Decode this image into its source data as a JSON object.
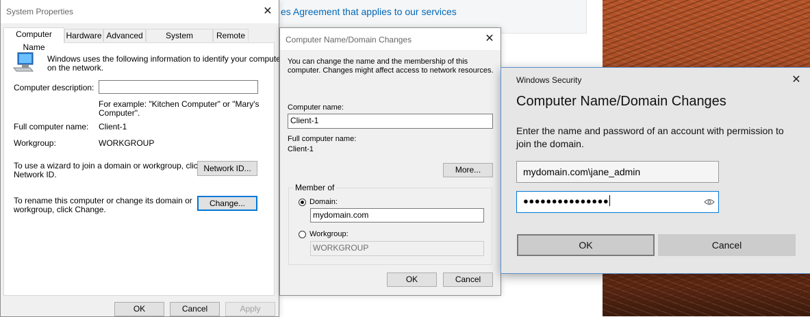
{
  "background": {
    "link_text": "es Agreement that applies to our services",
    "wallpaper": "desert-dunes"
  },
  "system_properties": {
    "title": "System Properties",
    "tabs": [
      "Computer Name",
      "Hardware",
      "Advanced",
      "System Protection",
      "Remote"
    ],
    "active_tab": "Computer Name",
    "intro_text_line1": "Windows uses the following information to identify your computer",
    "intro_text_line2": "on the network.",
    "description_label": "Computer description:",
    "description_value": "",
    "example_line1": "For example: \"Kitchen Computer\" or \"Mary's",
    "example_line2": "Computer\".",
    "full_name_label": "Full computer name:",
    "full_name_value": "Client-1",
    "workgroup_label": "Workgroup:",
    "workgroup_value": "WORKGROUP",
    "wizard_text_line1": "To use a wizard to join a domain or workgroup, click",
    "wizard_text_line2": "Network ID.",
    "network_id_button": "Network ID...",
    "rename_text_line1": "To rename this computer or change its domain or",
    "rename_text_line2": "workgroup, click Change.",
    "change_button": "Change...",
    "ok_button": "OK",
    "cancel_button": "Cancel",
    "apply_button": "Apply"
  },
  "computer_name_changes": {
    "title": "Computer Name/Domain Changes",
    "intro_line1": "You can change the name and the membership of this",
    "intro_line2": "computer. Changes might affect access to network resources.",
    "computer_name_label": "Computer name:",
    "computer_name_value": "Client-1",
    "full_name_label": "Full computer name:",
    "full_name_value": "Client-1",
    "more_button": "More...",
    "member_of_label": "Member of",
    "domain_label": "Domain:",
    "domain_value": "mydomain.com",
    "domain_selected": true,
    "workgroup_label": "Workgroup:",
    "workgroup_value": "WORKGROUP",
    "ok_button": "OK",
    "cancel_button": "Cancel"
  },
  "windows_security": {
    "title": "Windows Security",
    "heading": "Computer Name/Domain Changes",
    "message": "Enter the name and password of an account with permission to join the domain.",
    "username_value": "mydomain.com\\jane_admin",
    "password_masked": "●●●●●●●●●●●●●●●",
    "ok_button": "OK",
    "cancel_button": "Cancel",
    "accent_color": "#0078d7"
  }
}
